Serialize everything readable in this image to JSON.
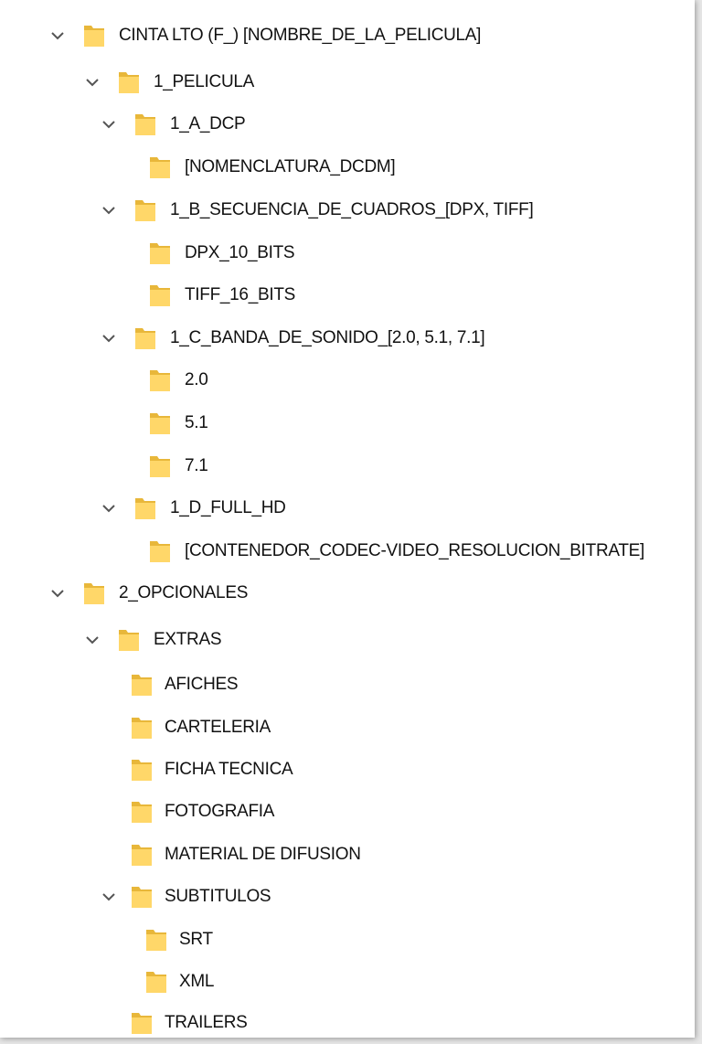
{
  "tree": {
    "root": {
      "label": "CINTA LTO (F_) [NOMBRE_DE_LA_PELICULA]",
      "children": {
        "pelicula": {
          "label": "1_PELICULA",
          "dcp": {
            "label": "1_A_DCP",
            "nomenclatura": "[NOMENCLATURA_DCDM]"
          },
          "secuencia": {
            "label": "1_B_SECUENCIA_DE_CUADROS_[DPX, TIFF]",
            "dpx": "DPX_10_BITS",
            "tiff": "TIFF_16_BITS"
          },
          "banda": {
            "label": "1_C_BANDA_DE_SONIDO_[2.0, 5.1, 7.1]",
            "s20": "2.0",
            "s51": "5.1",
            "s71": "7.1"
          },
          "fullhd": {
            "label": "1_D_FULL_HD",
            "contenedor": "[CONTENEDOR_CODEC-VIDEO_RESOLUCION_BITRATE]"
          }
        }
      }
    },
    "opcionales": {
      "label": "2_OPCIONALES",
      "extras": {
        "label": "EXTRAS",
        "afiches": "AFICHES",
        "carteleria": "CARTELERIA",
        "ficha": "FICHA TECNICA",
        "fotografia": "FOTOGRAFIA",
        "material": "MATERIAL DE DIFUSION",
        "subtitulos": {
          "label": "SUBTITULOS",
          "srt": "SRT",
          "xml": "XML"
        },
        "trailers": "TRAILERS"
      }
    }
  },
  "icons": {
    "folder": "folder-icon",
    "expanded": "chevron-down-icon"
  },
  "colors": {
    "folder_front": "#ffd769",
    "folder_back": "#e8b73a",
    "chevron": "#555555"
  }
}
